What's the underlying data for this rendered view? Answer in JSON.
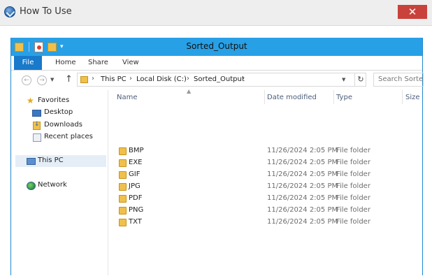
{
  "outer_window": {
    "title": "How To Use",
    "close_glyph": "✕"
  },
  "explorer": {
    "title": "Sorted_Output",
    "quick_access_dropdown": "▾",
    "ribbon_tabs": [
      "File",
      "Home",
      "Share",
      "View"
    ],
    "address": {
      "back": "←",
      "forward": "→",
      "up": "↑",
      "crumbs": [
        "This PC",
        "Local Disk (C:)",
        "Sorted_Output"
      ],
      "separator": "›",
      "refresh": "↻",
      "search_placeholder": "Search Sorted_Output"
    },
    "nav_pane": {
      "favorites": "Favorites",
      "desktop": "Desktop",
      "downloads": "Downloads",
      "recent": "Recent places",
      "this_pc": "This PC",
      "network": "Network"
    },
    "columns": {
      "name": "Name",
      "date": "Date modified",
      "type": "Type",
      "size": "Size",
      "sort_indicator": "▲"
    },
    "rows": [
      {
        "name": "BMP",
        "date": "11/26/2024 2:05 PM",
        "type": "File folder"
      },
      {
        "name": "EXE",
        "date": "11/26/2024 2:05 PM",
        "type": "File folder"
      },
      {
        "name": "GIF",
        "date": "11/26/2024 2:05 PM",
        "type": "File folder"
      },
      {
        "name": "JPG",
        "date": "11/26/2024 2:05 PM",
        "type": "File folder"
      },
      {
        "name": "PDF",
        "date": "11/26/2024 2:05 PM",
        "type": "File folder"
      },
      {
        "name": "PNG",
        "date": "11/26/2024 2:05 PM",
        "type": "File folder"
      },
      {
        "name": "TXT",
        "date": "11/26/2024 2:05 PM",
        "type": "File folder"
      }
    ]
  },
  "colors": {
    "title_bar": "#28a0e6",
    "file_tab": "#1979ca",
    "close_button": "#c9413b",
    "selection": "#e5eef7"
  },
  "icons": [
    "help-app-icon",
    "folder-icon",
    "properties-icon",
    "new-folder-icon",
    "star-icon",
    "desktop-icon",
    "downloads-icon",
    "recent-places-icon",
    "computer-icon",
    "network-icon",
    "refresh-icon"
  ]
}
